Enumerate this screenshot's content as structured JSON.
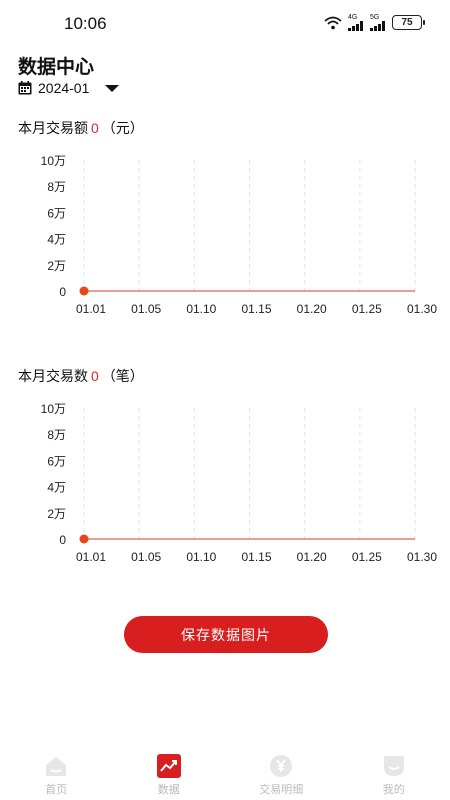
{
  "status_bar": {
    "time": "10:06",
    "signal_1": "4G",
    "signal_2": "5G",
    "battery": "75"
  },
  "header": {
    "title": "数据中心",
    "month": "2024-01"
  },
  "amount_section": {
    "label": "本月交易额",
    "value": "0",
    "unit": "（元）"
  },
  "count_section": {
    "label": "本月交易数",
    "value": "0",
    "unit": "（笔）"
  },
  "save_button": {
    "label": "保存数据图片"
  },
  "tabs": [
    {
      "label": "首页",
      "icon": "home-icon"
    },
    {
      "label": "数据",
      "icon": "chart-trend-icon"
    },
    {
      "label": "交易明细",
      "icon": "yen-icon"
    },
    {
      "label": "我的",
      "icon": "profile-icon"
    }
  ],
  "colors": {
    "accent": "#d81e1e",
    "line": "#e23a2e",
    "point": "#e8451a"
  },
  "chart_data": [
    {
      "type": "line",
      "x": [
        "01.01",
        "01.05",
        "01.10",
        "01.15",
        "01.20",
        "01.25",
        "01.30"
      ],
      "y_ticks": [
        "0",
        "2万",
        "4万",
        "6万",
        "8万",
        "10万"
      ],
      "ylim": [
        0,
        100000
      ],
      "series": [
        {
          "values": [
            0,
            0,
            0,
            0,
            0,
            0,
            0
          ]
        }
      ],
      "grid": "vertical-dashed"
    },
    {
      "type": "line",
      "x": [
        "01.01",
        "01.05",
        "01.10",
        "01.15",
        "01.20",
        "01.25",
        "01.30"
      ],
      "y_ticks": [
        "0",
        "2万",
        "4万",
        "6万",
        "8万",
        "10万"
      ],
      "ylim": [
        0,
        100000
      ],
      "series": [
        {
          "values": [
            0,
            0,
            0,
            0,
            0,
            0,
            0
          ]
        }
      ],
      "grid": "vertical-dashed"
    }
  ]
}
